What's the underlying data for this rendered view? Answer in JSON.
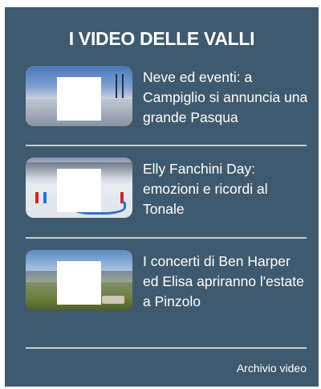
{
  "widget": {
    "title": "I VIDEO DELLE VALLI",
    "background": "#3f5a6e",
    "divider_color": "#c6d0d8"
  },
  "videos": [
    {
      "headline": "Neve ed eventi: a Campiglio si annuncia una grande Pasqua"
    },
    {
      "headline": "Elly Fanchini Day: emozioni e ricordi al Tonale"
    },
    {
      "headline": "I concerti di Ben Harper ed Elisa apriranno l'estate a Pinzolo"
    }
  ],
  "archive_link": "Archivio video"
}
